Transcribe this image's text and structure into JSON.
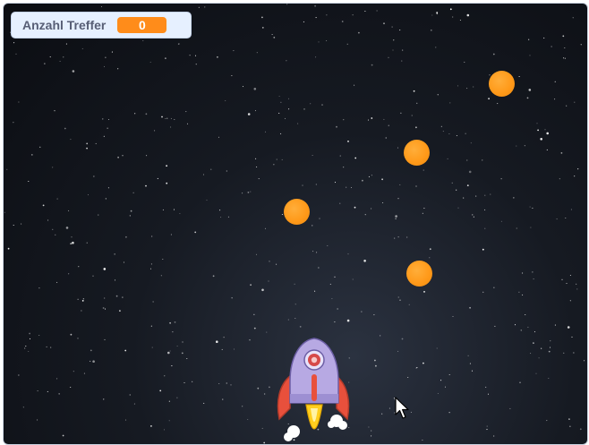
{
  "monitor": {
    "label": "Anzahl Treffer",
    "value": "0"
  },
  "colors": {
    "accent": "#ff8c1a",
    "monitor_bg": "#e6f0ff",
    "label_text": "#575e75",
    "sky": "#0b0d12"
  },
  "sprites": {
    "balls": [
      {
        "name": "ball-1"
      },
      {
        "name": "ball-2"
      },
      {
        "name": "ball-3"
      },
      {
        "name": "ball-4"
      }
    ],
    "player": "rocket",
    "pointer": "mouse-cursor"
  }
}
